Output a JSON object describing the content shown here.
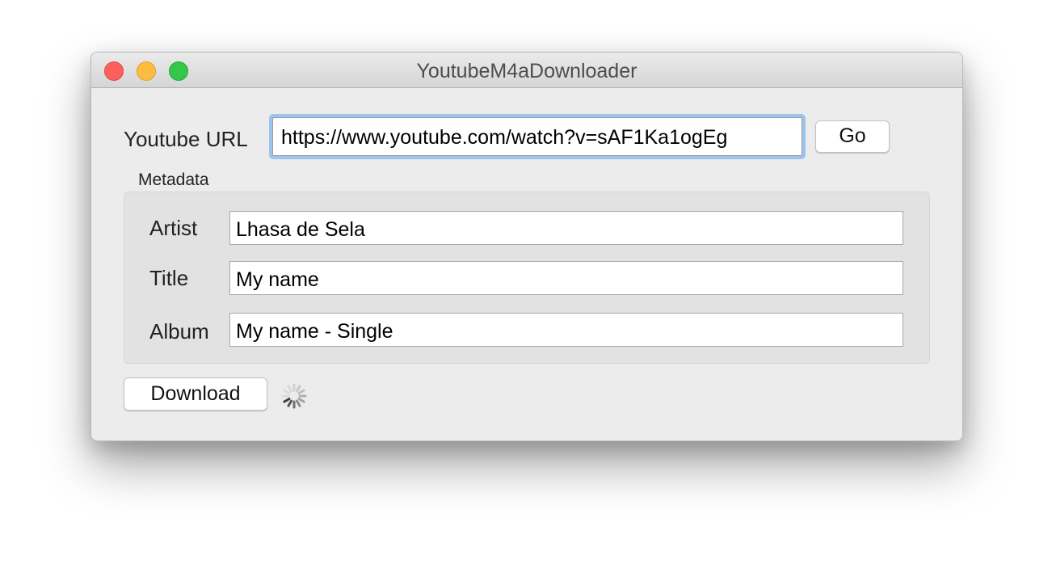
{
  "window": {
    "title": "YoutubeM4aDownloader"
  },
  "url_section": {
    "label": "Youtube URL",
    "value": "https://www.youtube.com/watch?v=sAF1Ka1ogEg",
    "go_label": "Go"
  },
  "metadata": {
    "group_title": "Metadata",
    "fields": [
      {
        "label": "Artist",
        "value": "Lhasa de Sela"
      },
      {
        "label": "Title",
        "value": "My name"
      },
      {
        "label": "Album",
        "value": "My name - Single"
      }
    ]
  },
  "footer": {
    "download_label": "Download",
    "activity_icon": "loading-spinner-icon"
  },
  "colors": {
    "close": "#fc605c",
    "minimize": "#fdbc40",
    "zoom": "#34c84a",
    "focus_ring": "#9dc3ef"
  }
}
